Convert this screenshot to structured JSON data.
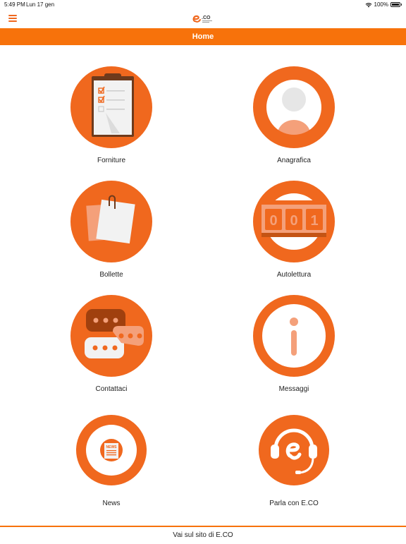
{
  "status": {
    "time": "5:49 PM",
    "date": "Lun 17 gen",
    "battery": "100%"
  },
  "brand": {
    "logo_text": "E.CO",
    "primary_color": "#f0681e",
    "header_color": "#f7720b"
  },
  "header": {
    "title": "Home"
  },
  "tiles": [
    {
      "label": "Forniture",
      "icon": "clipboard-checklist-icon"
    },
    {
      "label": "Anagrafica",
      "icon": "user-profile-icon"
    },
    {
      "label": "Bollette",
      "icon": "bill-paper-clip-icon"
    },
    {
      "label": "Autolettura",
      "icon": "meter-counter-icon"
    },
    {
      "label": "Contattaci",
      "icon": "chat-bubbles-icon"
    },
    {
      "label": "Messaggi",
      "icon": "info-icon"
    },
    {
      "label": "News",
      "icon": "newspaper-icon"
    },
    {
      "label": "Parla con E.CO",
      "icon": "headset-support-icon"
    }
  ],
  "meter": {
    "digits": [
      "0",
      "0",
      "1"
    ]
  },
  "news_badge": "NEWS",
  "footer": {
    "link_text": "Vai sul sito di E.CO"
  }
}
